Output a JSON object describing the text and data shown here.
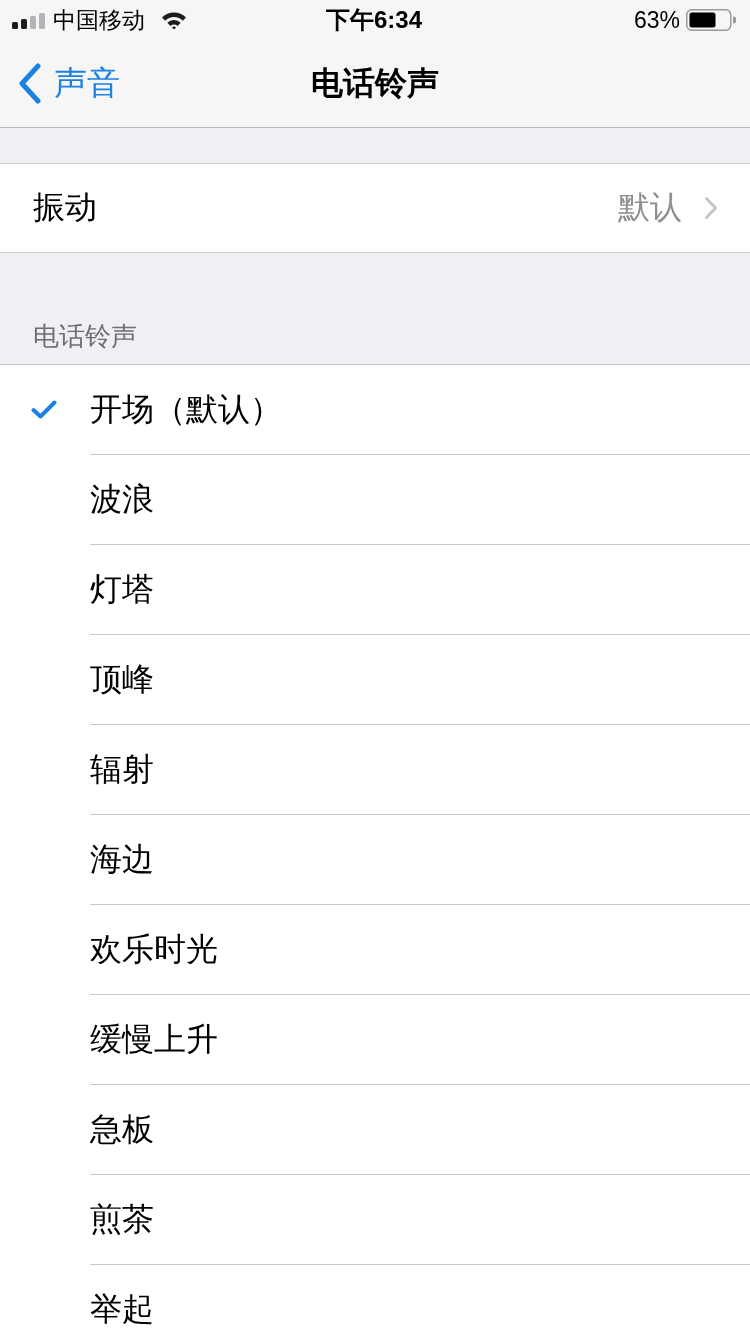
{
  "status_bar": {
    "carrier": "中国移动",
    "time": "下午6:34",
    "battery": "63%"
  },
  "nav_bar": {
    "back": "声音",
    "title": "电话铃声"
  },
  "vibration_row": {
    "label": "振动",
    "value": "默认"
  },
  "ringtone_section": {
    "header": "电话铃声",
    "items": [
      {
        "label": "开场（默认）",
        "selected": true
      },
      {
        "label": "波浪",
        "selected": false
      },
      {
        "label": "灯塔",
        "selected": false
      },
      {
        "label": "顶峰",
        "selected": false
      },
      {
        "label": "辐射",
        "selected": false
      },
      {
        "label": "海边",
        "selected": false
      },
      {
        "label": "欢乐时光",
        "selected": false
      },
      {
        "label": "缓慢上升",
        "selected": false
      },
      {
        "label": "急板",
        "selected": false
      },
      {
        "label": "煎茶",
        "selected": false
      },
      {
        "label": "举起",
        "selected": false
      }
    ]
  }
}
